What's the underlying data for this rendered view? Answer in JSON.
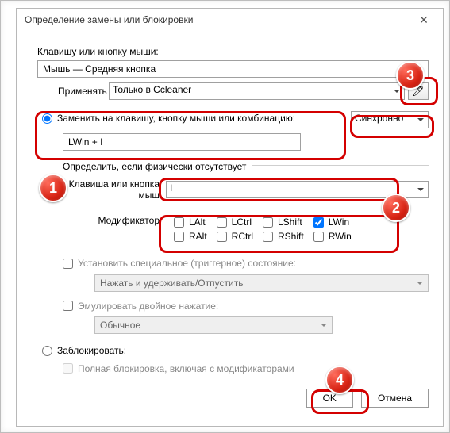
{
  "window": {
    "title": "Определение замены или блокировки"
  },
  "labels": {
    "keyOrMouse": "Клавишу или кнопку мыши:",
    "applyTo": "Применять",
    "defineIfMissing": "Определить, если физически отсутствует",
    "keyOrMouseButton": "Клавиша или кнопка мыш",
    "modifiers": "Модификатор",
    "setSpecial": "Установить специальное (триггерное) состояние:",
    "emulateDouble": "Эмулировать двойное нажатие:",
    "block": "Заблокировать:",
    "fullBlock": "Полная блокировка, включая с модификаторами"
  },
  "values": {
    "mainKey": "Мышь — Средняя кнопка",
    "applyTo": "Только в Ccleaner",
    "replaceRadioLabel": "Заменить на клавишу, кнопку мыши или комбинацию:",
    "replaceValue": "LWin + I",
    "syncMode": "Синхронно",
    "physicalKey": "I",
    "specialState": "Нажать и удерживать/Отпустить",
    "doublePress": "Обычное"
  },
  "mods": {
    "LAlt": "LAlt",
    "LCtrl": "LCtrl",
    "LShift": "LShift",
    "LWin": "LWin",
    "RAlt": "RAlt",
    "RCtrl": "RCtrl",
    "RShift": "RShift",
    "RWin": "RWin"
  },
  "modsChecked": {
    "LWin": true
  },
  "buttons": {
    "ok": "OK",
    "cancel": "Отмена"
  },
  "annotations": [
    "1",
    "2",
    "3",
    "4"
  ],
  "icons": {
    "close": "✕",
    "picker": "🖊"
  }
}
